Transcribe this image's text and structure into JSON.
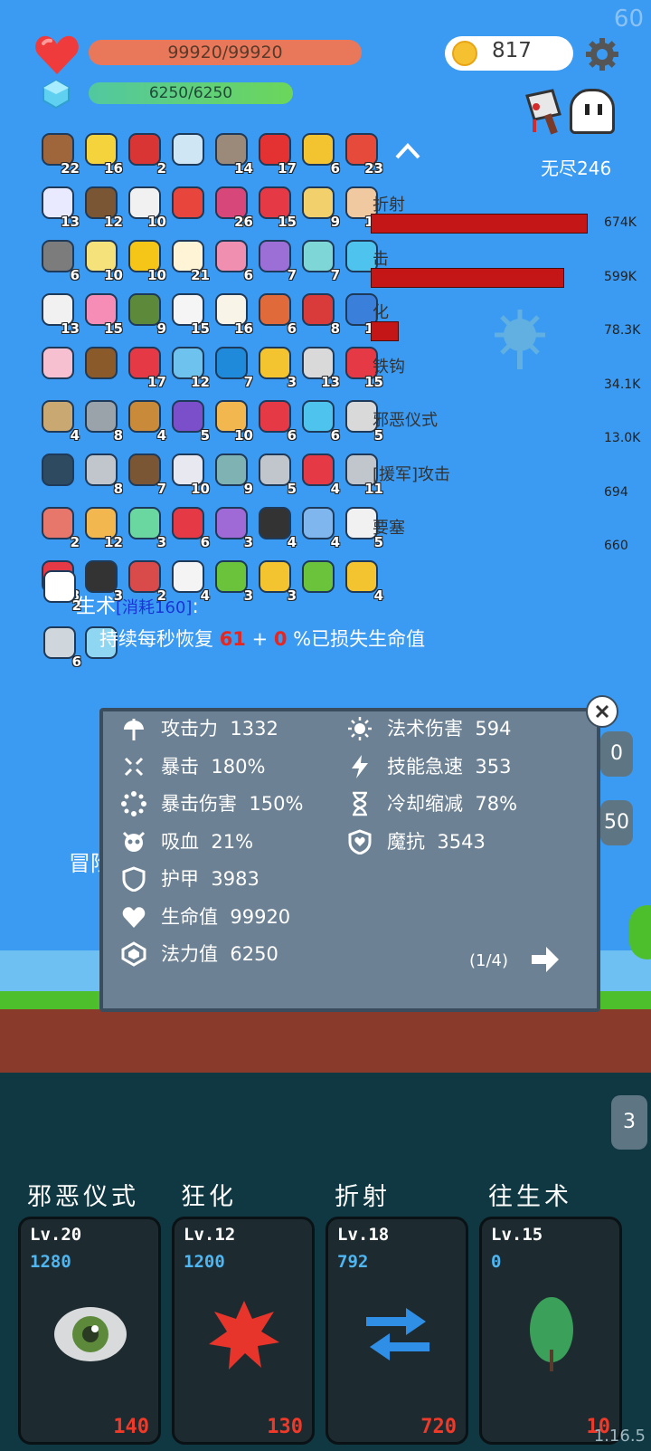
{
  "fps": "60",
  "player": {
    "hp_text": "99920/99920",
    "hp_fill": 1.0,
    "mp_text": "6250/6250",
    "mp_fill": 1.0
  },
  "coins": "817",
  "mode": {
    "label": "无尽246"
  },
  "inventory": [
    {
      "icon": "donut-icon",
      "count": "22",
      "color": "#a0663b"
    },
    {
      "icon": "sun-icon",
      "count": "16",
      "color": "#f4d33c"
    },
    {
      "icon": "magnet-icon",
      "count": "2",
      "color": "#d93535"
    },
    {
      "icon": "magnifier-icon",
      "count": "",
      "color": "#cfe6f5"
    },
    {
      "icon": "tombstone-icon",
      "count": "14",
      "color": "#9b8a7a"
    },
    {
      "icon": "apple-icon",
      "count": "17",
      "color": "#e43131"
    },
    {
      "icon": "crown-icon",
      "count": "6",
      "color": "#f4c430"
    },
    {
      "icon": "sock-icon",
      "count": "23",
      "color": "#e54a3b"
    },
    {
      "icon": "pill-icon",
      "count": "13",
      "color": "#e9e9ff"
    },
    {
      "icon": "coconut-icon",
      "count": "12",
      "color": "#7a5634"
    },
    {
      "icon": "capsule-icon",
      "count": "10",
      "color": "#f1f1f1"
    },
    {
      "icon": "sneaker-icon",
      "count": "",
      "color": "#e8453c"
    },
    {
      "icon": "jam-jar-icon",
      "count": "26",
      "color": "#d8477a"
    },
    {
      "icon": "heart-icon",
      "count": "15",
      "color": "#e63946"
    },
    {
      "icon": "note-pencil-icon",
      "count": "9",
      "color": "#f2d06b"
    },
    {
      "icon": "glove-icon",
      "count": "15",
      "color": "#f0c9a0"
    },
    {
      "icon": "spiked-mace-icon",
      "count": "6",
      "color": "#7c7c7c"
    },
    {
      "icon": "halo-icon",
      "count": "10",
      "color": "#f6e27a"
    },
    {
      "icon": "sunflower-icon",
      "count": "10",
      "color": "#f5c518"
    },
    {
      "icon": "fried-egg-icon",
      "count": "21",
      "color": "#fff5d6"
    },
    {
      "icon": "ice-cream-icon",
      "count": "6",
      "color": "#f08fb0"
    },
    {
      "icon": "star-shield-icon",
      "count": "7",
      "color": "#9b6fd6"
    },
    {
      "icon": "scroll-icon",
      "count": "7",
      "color": "#7fd6d6"
    },
    {
      "icon": "speech-bubble-icon",
      "count": "7",
      "color": "#4ec3ee"
    },
    {
      "icon": "playing-card-icon",
      "count": "13",
      "color": "#f1f1f1"
    },
    {
      "icon": "potion-bottle-icon",
      "count": "15",
      "color": "#f58db7"
    },
    {
      "icon": "grenade-icon",
      "count": "9",
      "color": "#5c8a3a"
    },
    {
      "icon": "dice-icon",
      "count": "15",
      "color": "#f5f5f5"
    },
    {
      "icon": "egg-icon",
      "count": "16",
      "color": "#f8f4e8"
    },
    {
      "icon": "meteor-icon",
      "count": "6",
      "color": "#e06a3a"
    },
    {
      "icon": "red-shield-icon",
      "count": "8",
      "color": "#d93a3a"
    },
    {
      "icon": "blue-shield-icon",
      "count": "16",
      "color": "#3a7fd9"
    },
    {
      "icon": "love-letter-icon",
      "count": "",
      "color": "#f7c0d0"
    },
    {
      "icon": "treasure-chest-icon",
      "count": "",
      "color": "#8a5a2a"
    },
    {
      "icon": "big-heart-icon",
      "count": "17",
      "color": "#e63946"
    },
    {
      "icon": "cat-potion-icon",
      "count": "12",
      "color": "#6ec3ee"
    },
    {
      "icon": "sapphire-icon",
      "count": "7",
      "color": "#1f8ad9"
    },
    {
      "icon": "ring-icon",
      "count": "3",
      "color": "#f4c430"
    },
    {
      "icon": "stopwatch-icon",
      "count": "13",
      "color": "#d9d9d9"
    },
    {
      "icon": "strawberry-icon",
      "count": "15",
      "color": "#e63946"
    },
    {
      "icon": "noose-icon",
      "count": "4",
      "color": "#caa872"
    },
    {
      "icon": "battle-axe-icon",
      "count": "8",
      "color": "#9aa3aa"
    },
    {
      "icon": "bow-icon",
      "count": "4",
      "color": "#c98a3a"
    },
    {
      "icon": "purple-box-icon",
      "count": "5",
      "color": "#7b4fc9"
    },
    {
      "icon": "parchment-icon",
      "count": "10",
      "color": "#f2b84f"
    },
    {
      "icon": "double-heart-icon",
      "count": "6",
      "color": "#e63946"
    },
    {
      "icon": "target-icon",
      "count": "6",
      "color": "#4ec3ee"
    },
    {
      "icon": "envelope-heart-icon",
      "count": "5",
      "color": "#d9d9d9"
    },
    {
      "icon": "skull-book-icon",
      "count": "",
      "color": "#2e4a60"
    },
    {
      "icon": "sword-icon",
      "count": "8",
      "color": "#c0c6cc"
    },
    {
      "icon": "coconut-drink-icon",
      "count": "7",
      "color": "#7a5634"
    },
    {
      "icon": "mail-icon",
      "count": "10",
      "color": "#e8e8f0"
    },
    {
      "icon": "disc-icon",
      "count": "9",
      "color": "#7fb3b3"
    },
    {
      "icon": "hook-icon",
      "count": "5",
      "color": "#c0c6cc"
    },
    {
      "icon": "red-flag-icon",
      "count": "4",
      "color": "#e63946"
    },
    {
      "icon": "compass-icon",
      "count": "11",
      "color": "#c0c6cc"
    },
    {
      "icon": "meat-icon",
      "count": "2",
      "color": "#e7776a"
    },
    {
      "icon": "golden-book-icon",
      "count": "12",
      "color": "#f2b84f"
    },
    {
      "icon": "green-bulb-icon",
      "count": "3",
      "color": "#6ad6a0"
    },
    {
      "icon": "mushroom-icon",
      "count": "6",
      "color": "#e63946"
    },
    {
      "icon": "crystal-ball-icon",
      "count": "3",
      "color": "#a06ad6"
    },
    {
      "icon": "cauldron-icon",
      "count": "4",
      "color": "#333333"
    },
    {
      "icon": "star-card-icon",
      "count": "4",
      "color": "#7fb6ee"
    },
    {
      "icon": "clipboard-icon",
      "count": "5",
      "color": "#f1f1f1"
    },
    {
      "icon": "gift-box-icon",
      "count": "8",
      "color": "#e63946"
    },
    {
      "icon": "bat-icon",
      "count": "3",
      "color": "#333333"
    },
    {
      "icon": "flask-icon",
      "count": "2",
      "color": "#d94a4a"
    },
    {
      "icon": "cloud-icon",
      "count": "4",
      "color": "#f4f4f4"
    },
    {
      "icon": "lime-icon",
      "count": "3",
      "color": "#6ac33a"
    },
    {
      "icon": "magic-wand-icon",
      "count": "3",
      "color": "#f4c430"
    },
    {
      "icon": "green-monster-icon",
      "count": "",
      "color": "#6ac33a"
    },
    {
      "icon": "coin-stack-icon",
      "count": "4",
      "color": "#f4c430"
    }
  ],
  "extra_items": [
    {
      "icon": "ghost-icon",
      "count": "2",
      "color": "#ffffff"
    },
    {
      "icon": "striped-tile-icon",
      "count": "6",
      "color": "#cfd6dc"
    },
    {
      "icon": "sparkle-tile-icon",
      "count": "",
      "color": "#8fd6f2"
    }
  ],
  "damage_stats": [
    {
      "name": "折射",
      "value": "674K",
      "ratio": 1.0
    },
    {
      "name": "击",
      "value": "599K",
      "ratio": 0.89
    },
    {
      "name": "化",
      "value": "78.3K",
      "ratio": 0.12
    },
    {
      "name": "铁钩",
      "value": "34.1K",
      "ratio": 0
    },
    {
      "name": "邪恶仪式",
      "value": "13.0K",
      "ratio": 0
    },
    {
      "name": "[援军]攻击",
      "value": "694",
      "ratio": 0
    },
    {
      "name": "要塞",
      "value": "660",
      "ratio": 0
    }
  ],
  "skill_desc": {
    "title": "生术",
    "cost": "[消耗160]",
    "colon": ":",
    "prefix": "持续每秒恢复 ",
    "v1": "61",
    "plus": " + ",
    "v2": "0",
    "suffix": " %已损失生命值"
  },
  "side_buttons": [
    "0",
    "50",
    "3"
  ],
  "stats": [
    {
      "icon": "axe-icon",
      "label": "攻击力",
      "value": "1332"
    },
    {
      "icon": "crit-icon",
      "label": "暴击",
      "value": "180%"
    },
    {
      "icon": "crit-damage-icon",
      "label": "暴击伤害",
      "value": "150%"
    },
    {
      "icon": "lifesteal-icon",
      "label": "吸血",
      "value": "21%"
    },
    {
      "icon": "armor-shield-icon",
      "label": "护甲",
      "value": "3983"
    },
    {
      "icon": "heart-outline-icon",
      "label": "生命值",
      "value": "99920"
    },
    {
      "icon": "mana-gem-icon",
      "label": "法力值",
      "value": "6250"
    },
    {
      "icon": "sun-outline-icon",
      "label": "法术伤害",
      "value": "594"
    },
    {
      "icon": "lightning-icon",
      "label": "技能急速",
      "value": "353"
    },
    {
      "icon": "hourglass-icon",
      "label": "冷却缩减",
      "value": "78%"
    },
    {
      "icon": "magic-shield-icon",
      "label": "魔抗",
      "value": "3543"
    }
  ],
  "stats_page": "(1/4)",
  "bg_text": "冒险",
  "skills": [
    {
      "name": "邪恶仪式",
      "level": "Lv.20",
      "value": "1280",
      "cost": "140",
      "icon": "evil-eye-icon"
    },
    {
      "name": "狂化",
      "level": "Lv.12",
      "value": "1200",
      "cost": "130",
      "icon": "rage-splat-icon"
    },
    {
      "name": "折射",
      "level": "Lv.18",
      "value": "792",
      "cost": "720",
      "icon": "refract-arrows-icon"
    },
    {
      "name": "往生术",
      "level": "Lv.15",
      "value": "0",
      "cost": "10",
      "icon": "leaf-icon"
    }
  ],
  "version": "1.16.5",
  "colors": {
    "accent": "#3b9bf2",
    "hp": "#e9785a",
    "damage_bar": "#c41616",
    "panel": "#6c8193"
  }
}
